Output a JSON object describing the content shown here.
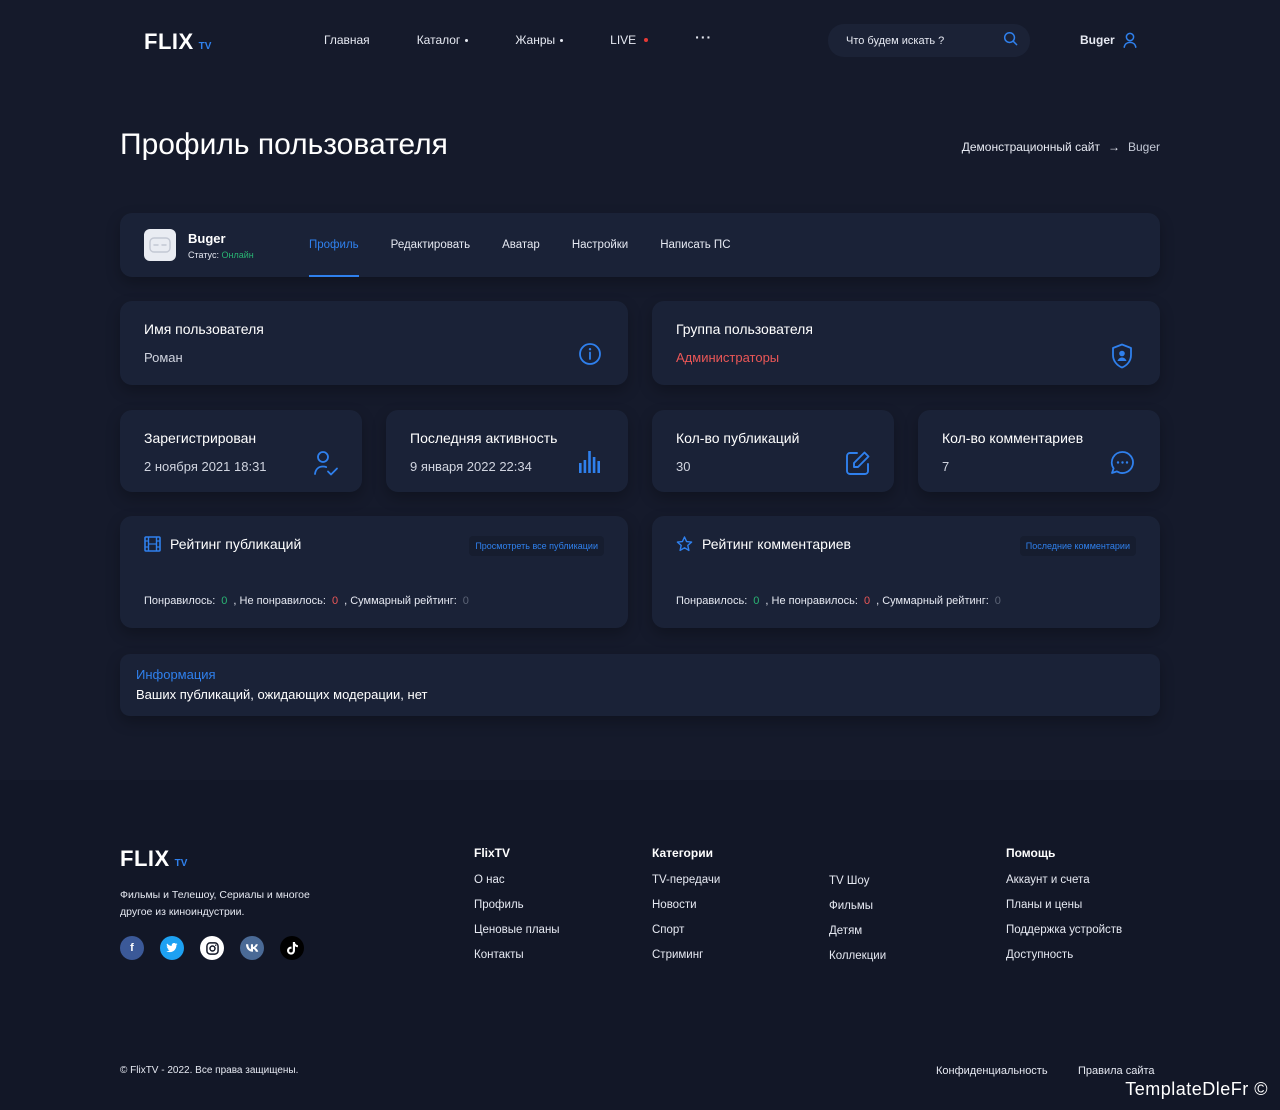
{
  "header": {
    "logo_main": "FLIX",
    "logo_sub": "TV",
    "nav": {
      "home": "Главная",
      "catalog": "Каталог",
      "genres": "Жанры",
      "live": "LIVE",
      "more": "···"
    },
    "search_placeholder": "Что будем искать ?",
    "username": "Buger"
  },
  "page": {
    "title": "Профиль пользователя",
    "breadcrumb": {
      "home": "Демонстрационный сайт",
      "arrow": "→",
      "current": "Buger"
    }
  },
  "profile": {
    "name": "Buger",
    "status_label": "Статус:",
    "status_value": "Онлайн",
    "tabs": [
      "Профиль",
      "Редактировать",
      "Аватар",
      "Настройки",
      "Написать ПС"
    ]
  },
  "info": {
    "username": {
      "label": "Имя пользователя",
      "value": "Роман"
    },
    "group": {
      "label": "Группа пользователя",
      "value": "Администраторы"
    },
    "registered": {
      "label": "Зарегистрирован",
      "value": "2 ноября 2021 18:31"
    },
    "last_activity": {
      "label": "Последняя активность",
      "value": "9 января 2022 22:34"
    },
    "publications": {
      "label": "Кол-во публикаций",
      "value": "30"
    },
    "comments": {
      "label": "Кол-во комментариев",
      "value": "7"
    }
  },
  "ratings": {
    "publications": {
      "title": "Рейтинг публикаций",
      "link": "Просмотреть все публикации",
      "liked_label": "Понравилось:",
      "liked": "0",
      "disliked_label": ", Не понравилось:",
      "disliked": "0",
      "total_label": ", Суммарный рейтинг:",
      "total": "0"
    },
    "comments": {
      "title": "Рейтинг комментариев",
      "link": "Последние комментарии",
      "liked_label": "Понравилось:",
      "liked": "0",
      "disliked_label": ", Не понравилось:",
      "disliked": "0",
      "total_label": ", Суммарный рейтинг:",
      "total": "0"
    }
  },
  "notice": {
    "title": "Информация",
    "text": "Ваших публикаций, ожидающих модерации, нет"
  },
  "footer": {
    "logo_main": "FLIX",
    "logo_sub": "TV",
    "description": "Фильмы и Телешоу, Сериалы и многое другое из киноиндустрии.",
    "col1": {
      "title": "FlixTV",
      "links": [
        "О нас",
        "Профиль",
        "Ценовые планы",
        "Контакты"
      ]
    },
    "col2": {
      "title": "Категории",
      "links": [
        "TV-передачи",
        "Новости",
        "Спорт",
        "Стриминг"
      ]
    },
    "col3": {
      "links": [
        "TV Шоу",
        "Фильмы",
        "Детям",
        "Коллекции"
      ]
    },
    "col4": {
      "title": "Помощь",
      "links": [
        "Аккаунт и счета",
        "Планы и цены",
        "Поддержка устройств",
        "Доступность"
      ]
    },
    "socials": [
      "f",
      "twitter-bird",
      "instagram",
      "vk",
      "tiktok"
    ],
    "copyright": "© FlixTV - 2022. Все права защищены.",
    "privacy": "Конфиденциальность",
    "rules": "Правила сайта"
  },
  "watermark": "TemplateDleFr ©",
  "colors": {
    "background": "#151a2b",
    "card": "#1a2237",
    "accent": "#2f80ed",
    "online": "#29b473",
    "danger": "#eb5757"
  }
}
